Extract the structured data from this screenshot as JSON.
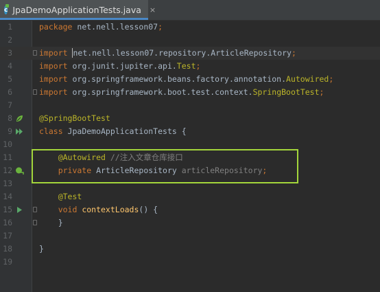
{
  "tab": {
    "icon": "java-class-icon",
    "icon_letter": "c",
    "title": "JpaDemoApplicationTests.java",
    "close": "×"
  },
  "lines": [
    {
      "num": "1",
      "segments": [
        {
          "t": "package ",
          "c": "kw"
        },
        {
          "t": "net.nell.lesson07",
          "c": ""
        },
        {
          "t": ";",
          "c": "kw"
        }
      ]
    },
    {
      "num": "2",
      "segments": []
    },
    {
      "num": "3",
      "caret": true,
      "fold": true,
      "segments": [
        {
          "t": "import ",
          "c": "kw"
        },
        {
          "t": "n",
          "c": "caret"
        },
        {
          "t": "et.nell.lesson07.repository.ArticleRepository",
          "c": ""
        },
        {
          "t": ";",
          "c": "kw"
        }
      ]
    },
    {
      "num": "4",
      "segments": [
        {
          "t": "import ",
          "c": "kw"
        },
        {
          "t": "org.junit.jupiter.api.",
          "c": ""
        },
        {
          "t": "Test",
          "c": "ann"
        },
        {
          "t": ";",
          "c": "kw"
        }
      ]
    },
    {
      "num": "5",
      "segments": [
        {
          "t": "import ",
          "c": "kw"
        },
        {
          "t": "org.springframework.beans.factory.annotation.",
          "c": ""
        },
        {
          "t": "Autowired",
          "c": "ann"
        },
        {
          "t": ";",
          "c": "kw"
        }
      ]
    },
    {
      "num": "6",
      "fold": true,
      "segments": [
        {
          "t": "import ",
          "c": "kw"
        },
        {
          "t": "org.springframework.boot.test.context.",
          "c": ""
        },
        {
          "t": "SpringBootTest",
          "c": "ann"
        },
        {
          "t": ";",
          "c": "kw"
        }
      ]
    },
    {
      "num": "7",
      "segments": []
    },
    {
      "num": "8",
      "icon": "spring-bean-icon",
      "segments": [
        {
          "t": "@SpringBootTest",
          "c": "ann"
        }
      ]
    },
    {
      "num": "9",
      "icon": "run-all-tests-icon",
      "segments": [
        {
          "t": "class ",
          "c": "kw"
        },
        {
          "t": "JpaDemoApplicationTests {",
          "c": ""
        }
      ]
    },
    {
      "num": "10",
      "segments": []
    },
    {
      "num": "11",
      "segments": [
        {
          "t": "    @Autowired ",
          "c": "ann"
        },
        {
          "t": "//注入文章仓库接口",
          "c": "cmt"
        }
      ]
    },
    {
      "num": "12",
      "icon": "autowired-navigate-icon",
      "segments": [
        {
          "t": "    private ",
          "c": "kw"
        },
        {
          "t": "ArticleRepository ",
          "c": ""
        },
        {
          "t": "articleRepository",
          "c": "dim"
        },
        {
          "t": ";",
          "c": "kw"
        }
      ]
    },
    {
      "num": "13",
      "segments": []
    },
    {
      "num": "14",
      "segments": [
        {
          "t": "    @Test",
          "c": "ann"
        }
      ]
    },
    {
      "num": "15",
      "icon": "run-test-icon",
      "fold": true,
      "segments": [
        {
          "t": "    void ",
          "c": "kw"
        },
        {
          "t": "contextLoads",
          "c": "fn"
        },
        {
          "t": "() {",
          "c": ""
        }
      ]
    },
    {
      "num": "16",
      "fold": true,
      "segments": [
        {
          "t": "    }",
          "c": ""
        }
      ]
    },
    {
      "num": "17",
      "segments": []
    },
    {
      "num": "18",
      "segments": [
        {
          "t": "}",
          "c": ""
        }
      ]
    },
    {
      "num": "19",
      "segments": []
    }
  ]
}
